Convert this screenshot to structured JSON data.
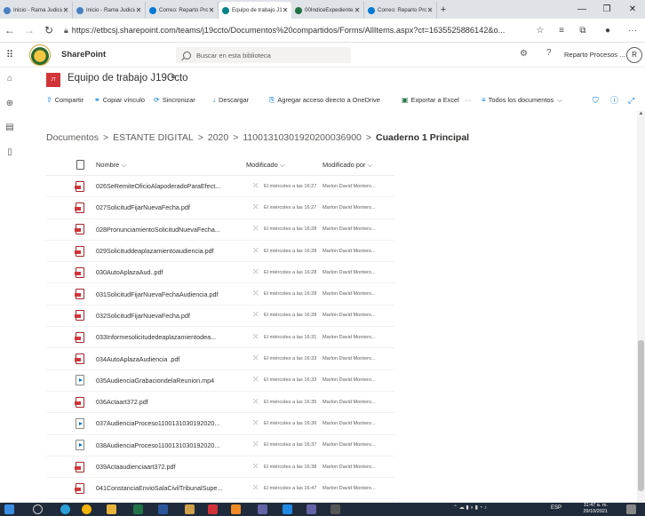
{
  "browser": {
    "tabs": [
      {
        "label": "Inicio - Rama Judicial",
        "favicon_color": "#4a7fc1",
        "active": false
      },
      {
        "label": "Inicio - Rama Judicial",
        "favicon_color": "#4a7fc1",
        "active": false
      },
      {
        "label": "Correo: Reparto Proc",
        "favicon_color": "#0078d4",
        "active": false
      },
      {
        "label": "Equipo de trabajo J1",
        "favicon_color": "#038387",
        "active": true
      },
      {
        "label": "00IndiceExpedienteJ",
        "favicon_color": "#217346",
        "active": false
      },
      {
        "label": "Correo: Reparto Proc",
        "favicon_color": "#0078d4",
        "active": false
      }
    ],
    "new_tab": "+",
    "window_controls": {
      "minimize": "—",
      "maximize": "❐",
      "close": "✕"
    },
    "url": "https://etbcsj.sharepoint.com/teams/j19ccto/Documentos%20compartidos/Forms/AllItems.aspx?ct=1635525886142&o..."
  },
  "suite": {
    "app_name": "SharePoint",
    "search_placeholder": "Buscar en esta biblioteca",
    "user_name": "Reparto Procesos ...",
    "avatar_initial": "R"
  },
  "site": {
    "logo_text": "JT",
    "title": "Equipo de trabajo J19Ccto"
  },
  "commands": {
    "share": "Compartir",
    "copy_link": "Copiar vínculo",
    "sync": "Sincronizar",
    "download": "Descargar",
    "add_shortcut": "Agregar acceso directo a OneDrive",
    "export_excel": "Exportar a Excel",
    "more": "···",
    "view": "Todos los documentos"
  },
  "breadcrumb": {
    "items": [
      "Documentos",
      "ESTANTE DIGITAL",
      "2020",
      "11001310301920200036900"
    ],
    "separator": ">",
    "current": "Cuaderno 1 Principal"
  },
  "columns": {
    "name": "Nombre",
    "modified": "Modificado",
    "modified_by": "Modificado por"
  },
  "files": [
    {
      "name": "026SeRemiteOficioAlapoderadoParaEfect...",
      "type": "pdf",
      "modified": "El miércoles a las 16:27",
      "by": "Marlon David Montero..."
    },
    {
      "name": "027SolicitudFijarNuevaFecha.pdf",
      "type": "pdf",
      "modified": "El miércoles a las 16:27",
      "by": "Marlon David Montero..."
    },
    {
      "name": "028PronunciamientoSolicitudNuevaFecha...",
      "type": "pdf",
      "modified": "El miércoles a las 16:28",
      "by": "Marlon David Montero..."
    },
    {
      "name": "029Solicituddeaplazamientoaudiencia.pdf",
      "type": "pdf",
      "modified": "El miércoles a las 16:28",
      "by": "Marlon David Montero..."
    },
    {
      "name": "030AutoAplazaAud..pdf",
      "type": "pdf",
      "modified": "El miércoles a las 16:28",
      "by": "Marlon David Montero..."
    },
    {
      "name": "031SolicitudFijarNuevaFechaAudiencia.pdf",
      "type": "pdf",
      "modified": "El miércoles a las 16:28",
      "by": "Marlon David Montero..."
    },
    {
      "name": "032SolicitudFijarNuevaFecha.pdf",
      "type": "pdf",
      "modified": "El miércoles a las 16:28",
      "by": "Marlon David Montero..."
    },
    {
      "name": "033Informesolicitudedeaplazamientodea...",
      "type": "pdf",
      "modified": "El miércoles a las 16:31",
      "by": "Marlon David Montero..."
    },
    {
      "name": "034AutoAplazaAudiencia .pdf",
      "type": "pdf",
      "modified": "El miércoles a las 16:33",
      "by": "Marlon David Montero..."
    },
    {
      "name": "035AudienciaGrabaciondelaReunion.mp4",
      "type": "video",
      "modified": "El miércoles a las 16:33",
      "by": "Marlon David Montero..."
    },
    {
      "name": "036Actaart372.pdf",
      "type": "pdf",
      "modified": "El miércoles a las 16:35",
      "by": "Marlon David Montero..."
    },
    {
      "name": "037AudienciaProceso1100131030192020...",
      "type": "video",
      "modified": "El miércoles a las 16:36",
      "by": "Marlon David Montero..."
    },
    {
      "name": "038AudienciaProceso1100131030192020...",
      "type": "video",
      "modified": "El miércoles a las 16:37",
      "by": "Marlon David Montero..."
    },
    {
      "name": "039Actaaudienciaart372.pdf",
      "type": "pdf",
      "modified": "El miércoles a las 16:38",
      "by": "Marlon David Montero..."
    },
    {
      "name": "041ConstanciaEnvioSalaCivilTribunalSupe...",
      "type": "pdf",
      "modified": "El miércoles a las 16:47",
      "by": "Marlon David Montero..."
    }
  ],
  "taskbar": {
    "language": "ESP",
    "time": "11:47 a. m.",
    "date": "29/10/2021"
  }
}
